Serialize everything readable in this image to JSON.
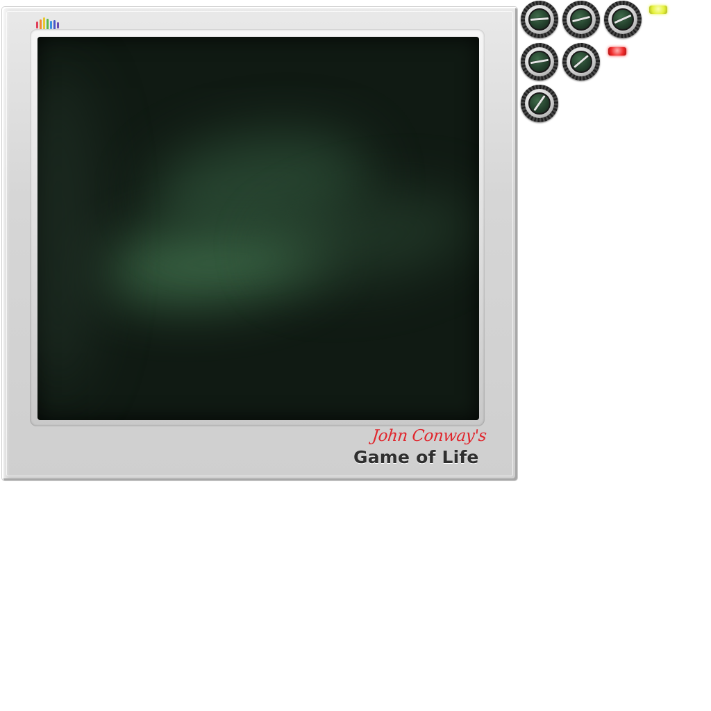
{
  "app": {
    "subtitle": "John Conway's",
    "title": "Game of Life"
  },
  "logo": {
    "icon": "equalizer-logo-icon",
    "bar_colors": [
      "#e0405a",
      "#f08a30",
      "#e8c830",
      "#5cb848",
      "#3a8ee0",
      "#4a58c8",
      "#6a4ab0"
    ]
  },
  "screen": {
    "background": "#101a13",
    "glow_color": "#3f6e4b"
  },
  "controls": {
    "knobs": [
      {
        "id": "knob-1",
        "icon": "dial-knob-icon"
      },
      {
        "id": "knob-2",
        "icon": "dial-knob-icon"
      },
      {
        "id": "knob-3",
        "icon": "dial-knob-icon"
      },
      {
        "id": "knob-4",
        "icon": "dial-knob-icon"
      },
      {
        "id": "knob-5",
        "icon": "dial-knob-icon"
      },
      {
        "id": "knob-6",
        "icon": "dial-knob-icon"
      }
    ],
    "leds": [
      {
        "id": "led-yellow",
        "color": "#e4f03a"
      },
      {
        "id": "led-red",
        "color": "#f02a2a"
      }
    ]
  }
}
